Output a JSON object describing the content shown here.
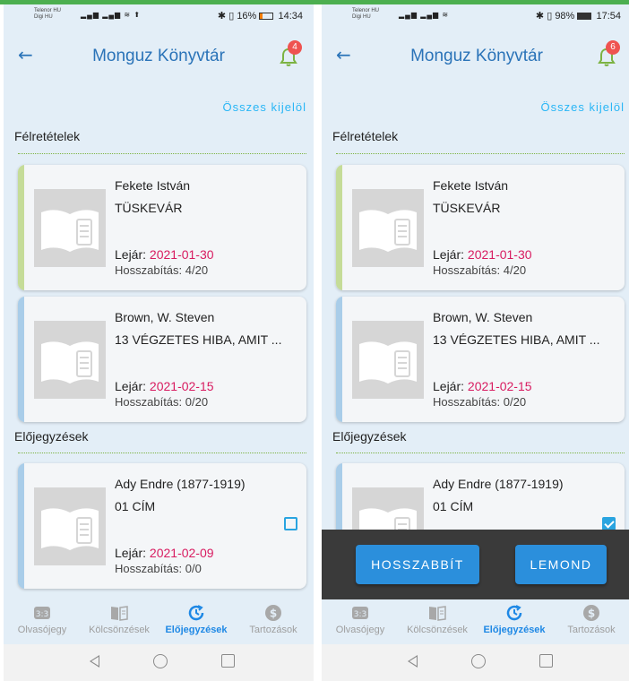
{
  "colors": {
    "accent": "#2a73b8",
    "due_date": "#d81b60",
    "select_all": "#29b6f6",
    "badge": "#ef5350",
    "stripe_green": "#c5dc98",
    "stripe_blue": "#a9cde9",
    "action_bar": "#3a3a3a",
    "action_button": "#2b8fdc"
  },
  "screens": [
    {
      "status": {
        "carrier1": "Telenor HU",
        "carrier2": "Digi HU",
        "battery": "16%",
        "time": "14:34"
      },
      "title": "Monguz Könyvtár",
      "notifications": "4",
      "select_all": "Összes kijelöl",
      "section_reservations": "Félretételek",
      "section_holds": "Előjegyzések",
      "cards": [
        {
          "author": "Fekete István",
          "title": "TÜSKEVÁR",
          "due_label": "Lejár:",
          "due_date": "2021-01-30",
          "extension": "Hosszabítás: 4/20"
        },
        {
          "author": "Brown, W. Steven",
          "title": "13 VÉGZETES HIBA, AMIT ...",
          "due_label": "Lejár:",
          "due_date": "2021-02-15",
          "extension": "Hosszabítás: 0/20"
        },
        {
          "author": "Ady Endre (1877-1919)",
          "title": "01 CÍM",
          "due_label": "Lejár:",
          "due_date": "2021-02-09",
          "extension": "Hosszabítás: 0/0"
        }
      ],
      "nav": [
        "Olvasójegy",
        "Kölcsönzések",
        "Előjegyzések",
        "Tartozások"
      ]
    },
    {
      "status": {
        "carrier1": "Telenor HU",
        "carrier2": "Digi HU",
        "battery": "98%",
        "time": "17:54"
      },
      "title": "Monguz Könyvtár",
      "notifications": "6",
      "select_all": "Összes kijelöl",
      "section_reservations": "Félretételek",
      "section_holds": "Előjegyzések",
      "cards": [
        {
          "author": "Fekete István",
          "title": "TÜSKEVÁR",
          "due_label": "Lejár:",
          "due_date": "2021-01-30",
          "extension": "Hosszabítás: 4/20"
        },
        {
          "author": "Brown, W. Steven",
          "title": "13 VÉGZETES HIBA, AMIT ...",
          "due_label": "Lejár:",
          "due_date": "2021-02-15",
          "extension": "Hosszabítás: 0/20"
        },
        {
          "author": "Ady Endre (1877-1919)",
          "title": "01 CÍM"
        }
      ],
      "actions": {
        "extend": "HOSSZABBÍT",
        "cancel": "LEMOND"
      },
      "nav": [
        "Olvasójegy",
        "Kölcsönzések",
        "Előjegyzések",
        "Tartozások"
      ]
    }
  ]
}
